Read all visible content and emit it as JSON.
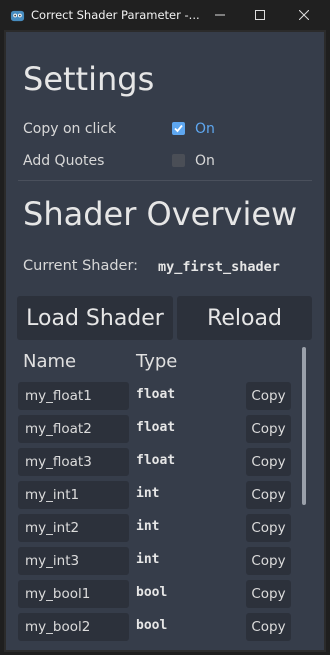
{
  "window": {
    "title": "Correct Shader Parameter -...",
    "icon": "godot-icon",
    "controls": [
      "minimize-icon",
      "maximize-icon",
      "close-icon"
    ]
  },
  "settings": {
    "heading": "Settings",
    "copy_on_click": {
      "label": "Copy on click",
      "checked": true,
      "state_label": "On"
    },
    "add_quotes": {
      "label": "Add Quotes",
      "checked": false,
      "state_label": "On"
    }
  },
  "overview": {
    "heading": "Shader Overview",
    "current_shader_label": "Current Shader:",
    "current_shader_value": "my_first_shader",
    "load_button": "Load Shader",
    "reload_button": "Reload",
    "col_name": "Name",
    "col_type": "Type",
    "copy_label": "Copy",
    "params": [
      {
        "name": "my_float1",
        "type": "float"
      },
      {
        "name": "my_float2",
        "type": "float"
      },
      {
        "name": "my_float3",
        "type": "float"
      },
      {
        "name": "my_int1",
        "type": "int"
      },
      {
        "name": "my_int2",
        "type": "int"
      },
      {
        "name": "my_int3",
        "type": "int"
      },
      {
        "name": "my_bool1",
        "type": "bool"
      },
      {
        "name": "my_bool2",
        "type": "bool"
      }
    ]
  },
  "colors": {
    "panel_bg": "#363d4a",
    "button_bg": "#2c313b",
    "accent": "#5ea7f0",
    "titlebar_bg": "#202020"
  }
}
